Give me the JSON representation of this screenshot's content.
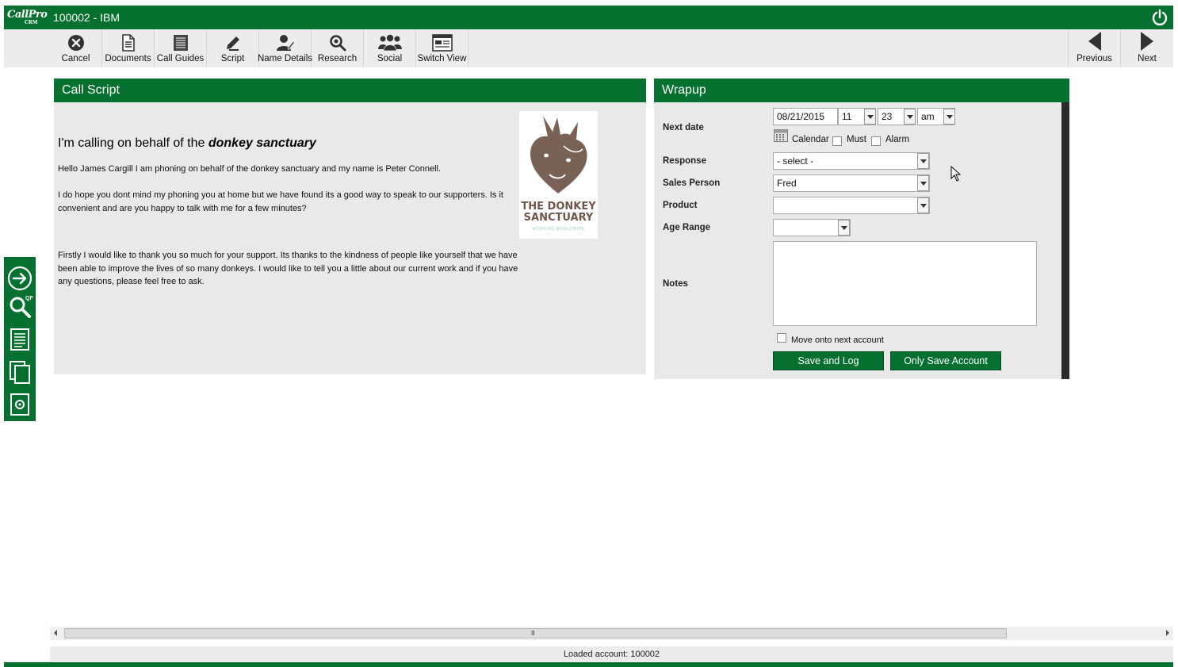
{
  "window": {
    "app_logo": "CallPro CRM",
    "title": "100002 - IBM"
  },
  "toolbar": {
    "left": [
      {
        "label": "Cancel",
        "icon": "cancel-icon"
      },
      {
        "label": "Documents",
        "icon": "document-icon"
      },
      {
        "label": "Call Guides",
        "icon": "call-guides-icon"
      },
      {
        "label": "Script",
        "icon": "script-icon"
      },
      {
        "label": "Name Details",
        "icon": "name-details-icon"
      },
      {
        "label": "Research",
        "icon": "research-icon"
      },
      {
        "label": "Social",
        "icon": "social-icon"
      },
      {
        "label": "Switch View",
        "icon": "switch-view-icon"
      }
    ],
    "previous_label": "Previous",
    "next_label": "Next"
  },
  "sidebar": {
    "icons": [
      "arrow-right-circle-icon",
      "quick-find-search-icon",
      "notes-icon",
      "copy-pages-icon",
      "disc-document-icon"
    ],
    "qf_badge": "QF"
  },
  "call_script": {
    "title": "Call Script",
    "heading_prefix": "I'm calling on behalf of the ",
    "heading_emphasis": "donkey sanctuary",
    "para1": "Hello James Cargill I am phoning on behalf of the donkey sanctuary and my name is Peter Connell.",
    "para2": "I do hope you dont mind my phoning you at home but we have found its a good way to speak to our supporters. Is it convenient and are you happy to talk with me for a few minutes?",
    "para3": "Firstly I would like to thank you so much for your support. Its thanks to the kindness of people like yourself that we have been able to improve the lives of so many donkeys. I would like to tell you a little about our current work and if you have any questions, please feel free to ask.",
    "logo": {
      "line1": "THE DONKEY",
      "line2": "SANCTUARY",
      "line3": "WORKING WORLDWIDE"
    }
  },
  "wrapup": {
    "title": "Wrapup",
    "next_date_label": "Next date",
    "date_value": "08/21/2015",
    "hour_value": "11",
    "minute_value": "23",
    "ampm_value": "am",
    "calendar_label": "Calendar",
    "must_label": "Must",
    "alarm_label": "Alarm",
    "response_label": "Response",
    "response_value": "- select -",
    "sales_person_label": "Sales Person",
    "sales_person_value": "Fred",
    "product_label": "Product",
    "product_value": "",
    "age_range_label": "Age Range",
    "age_range_value": "",
    "notes_label": "Notes",
    "move_next_label": "Move onto next account",
    "save_log_label": "Save and Log",
    "only_save_label": "Only Save Account"
  },
  "status": {
    "text": "Loaded account: 100002",
    "scroll_grip": "III"
  },
  "colors": {
    "brand_green": "#05702f",
    "panel_bg": "#e9e9e9",
    "toolbar_bg": "#ececec"
  }
}
